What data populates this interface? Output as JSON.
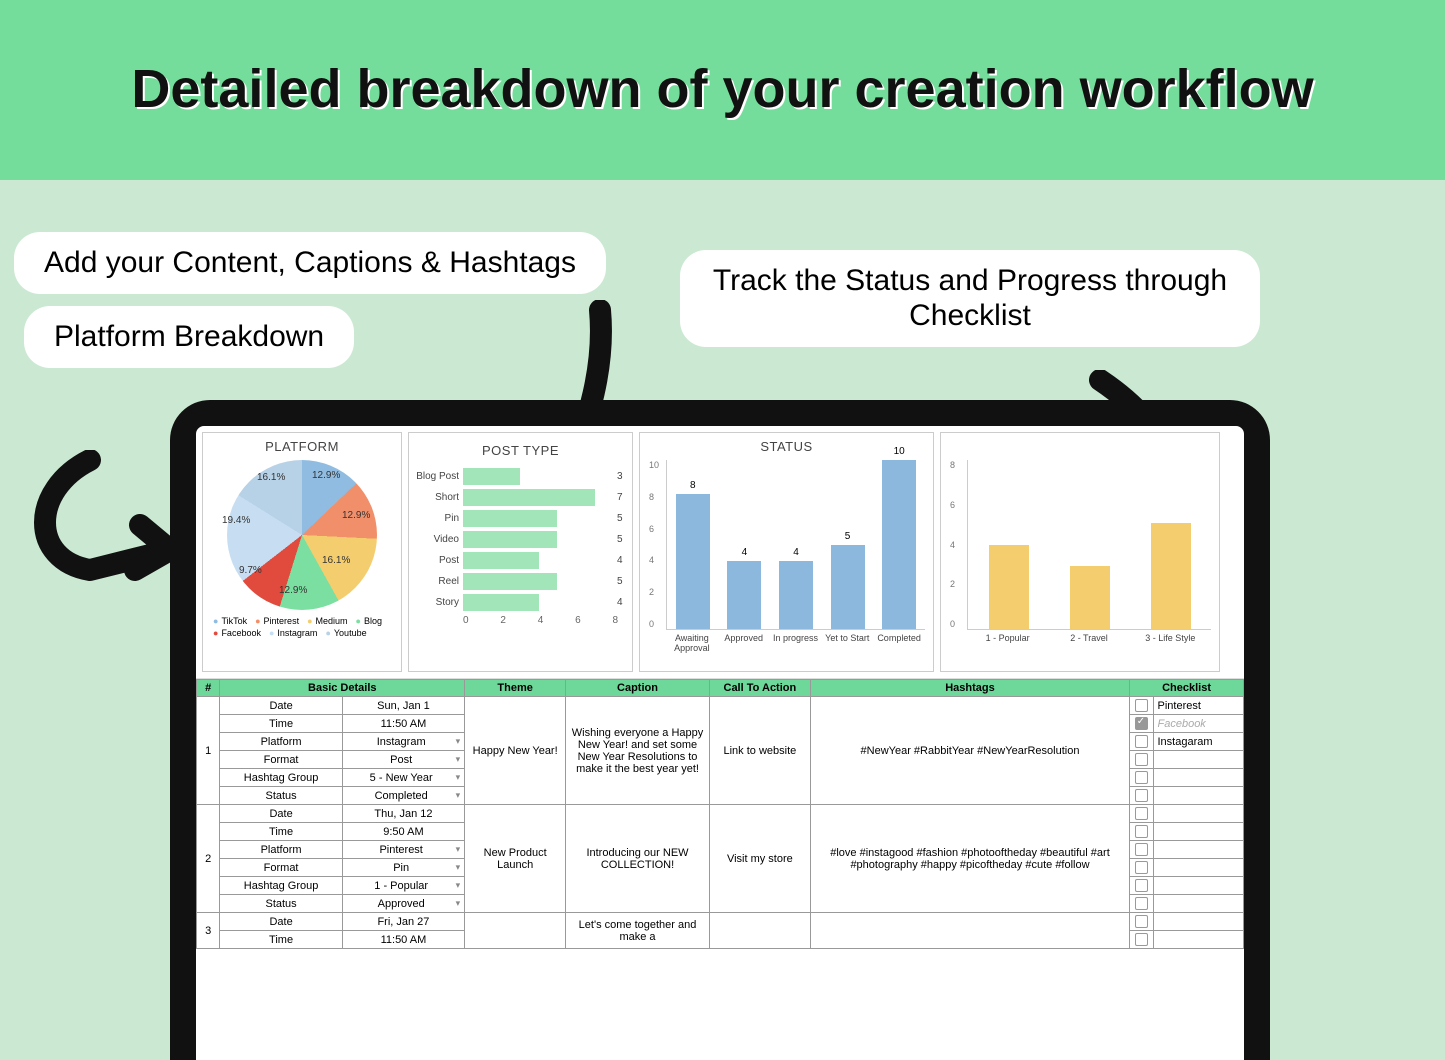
{
  "header": {
    "title": "Detailed breakdown of your creation workflow"
  },
  "callouts": {
    "c1": "Add your Content, Captions & Hashtags",
    "c2": "Platform  Breakdown",
    "c3": "Track the Status and Progress through Checklist"
  },
  "charts": {
    "platform": {
      "title": "PLATFORM",
      "slices": [
        {
          "label": "TikTok",
          "pct": "12.9%"
        },
        {
          "label": "Pinterest",
          "pct": "12.9%"
        },
        {
          "label": "Medium",
          "pct": "16.1%"
        },
        {
          "label": "Blog",
          "pct": "12.9%"
        },
        {
          "label": "Facebook",
          "pct": "9.7%"
        },
        {
          "label": "Instagram",
          "pct": "19.4%"
        },
        {
          "label": "Youtube",
          "pct": "16.1%"
        }
      ]
    },
    "posttype": {
      "title": "POST TYPE",
      "items": [
        {
          "label": "Blog Post",
          "value": 3
        },
        {
          "label": "Short",
          "value": 7
        },
        {
          "label": "Pin",
          "value": 5
        },
        {
          "label": "Video",
          "value": 5
        },
        {
          "label": "Post",
          "value": 4
        },
        {
          "label": "Reel",
          "value": 5
        },
        {
          "label": "Story",
          "value": 4
        }
      ],
      "axis": [
        "0",
        "2",
        "4",
        "6",
        "8"
      ]
    },
    "status": {
      "title": "STATUS",
      "items": [
        {
          "label": "Awaiting Approval",
          "value": 8
        },
        {
          "label": "Approved",
          "value": 4
        },
        {
          "label": "In progress",
          "value": 4
        },
        {
          "label": "Yet to Start",
          "value": 5
        },
        {
          "label": "Completed",
          "value": 10
        }
      ],
      "yticks": [
        "10",
        "8",
        "6",
        "4",
        "2",
        "0"
      ]
    },
    "theme": {
      "yticks": [
        "8",
        "6",
        "4",
        "2",
        "0"
      ],
      "items": [
        {
          "label": "1 - Popular",
          "value": 4
        },
        {
          "label": "2 - Travel",
          "value": 3
        },
        {
          "label": "3 - Life Style",
          "value": 5
        }
      ]
    }
  },
  "sheet": {
    "headers": {
      "num": "#",
      "basic": "Basic Details",
      "theme": "Theme",
      "caption": "Caption",
      "cta": "Call To Action",
      "hashtags": "Hashtags",
      "checklist": "Checklist"
    },
    "rowlabels": [
      "Date",
      "Time",
      "Platform",
      "Format",
      "Hashtag Group",
      "Status"
    ],
    "rows": [
      {
        "num": "1",
        "vals": [
          "Sun, Jan 1",
          "11:50 AM",
          "Instagram",
          "Post",
          "5 - New Year",
          "Completed"
        ],
        "theme": "Happy New Year!",
        "caption": "Wishing everyone a Happy New Year! and set some New Year Resolutions to make it the best year yet!",
        "cta": "Link to website",
        "hashtags": "#NewYear #RabbitYear #NewYearResolution",
        "chk": [
          {
            "label": "Pinterest",
            "on": false
          },
          {
            "label": "Facebook",
            "on": true,
            "faded": true
          },
          {
            "label": "Instagaram",
            "on": false
          },
          {
            "label": "",
            "on": false
          },
          {
            "label": "",
            "on": false
          },
          {
            "label": "",
            "on": false
          }
        ]
      },
      {
        "num": "2",
        "vals": [
          "Thu, Jan 12",
          "9:50 AM",
          "Pinterest",
          "Pin",
          "1 - Popular",
          "Approved"
        ],
        "theme": "New Product Launch",
        "caption": "Introducing our NEW COLLECTION!",
        "cta": "Visit my store",
        "hashtags": "#love #instagood #fashion #photooftheday #beautiful #art #photography #happy #picoftheday #cute #follow",
        "chk": [
          {
            "label": "",
            "on": false
          },
          {
            "label": "",
            "on": false
          },
          {
            "label": "",
            "on": false
          },
          {
            "label": "",
            "on": false
          },
          {
            "label": "",
            "on": false
          },
          {
            "label": "",
            "on": false
          }
        ]
      },
      {
        "num": "3",
        "vals": [
          "Fri, Jan 27",
          "11:50 AM"
        ],
        "theme": "",
        "caption": "Let's come together and make a",
        "cta": "",
        "hashtags": "",
        "chk": [
          {
            "label": "",
            "on": false
          },
          {
            "label": "",
            "on": false
          }
        ]
      }
    ]
  },
  "chart_data": [
    {
      "type": "pie",
      "title": "PLATFORM",
      "categories": [
        "TikTok",
        "Pinterest",
        "Medium",
        "Blog",
        "Facebook",
        "Instagram",
        "Youtube"
      ],
      "values": [
        12.9,
        12.9,
        16.1,
        12.9,
        9.7,
        19.4,
        16.1
      ]
    },
    {
      "type": "bar",
      "title": "POST TYPE",
      "orientation": "horizontal",
      "categories": [
        "Blog Post",
        "Short",
        "Pin",
        "Video",
        "Post",
        "Reel",
        "Story"
      ],
      "values": [
        3,
        7,
        5,
        5,
        4,
        5,
        4
      ],
      "xlim": [
        0,
        8
      ]
    },
    {
      "type": "bar",
      "title": "STATUS",
      "categories": [
        "Awaiting Approval",
        "Approved",
        "In progress",
        "Yet to Start",
        "Completed"
      ],
      "values": [
        8,
        4,
        4,
        5,
        10
      ],
      "ylim": [
        0,
        10
      ]
    },
    {
      "type": "bar",
      "title": "THEME",
      "categories": [
        "1 - Popular",
        "2 - Travel",
        "3 - Life Style"
      ],
      "values": [
        4,
        3,
        5
      ],
      "ylim": [
        0,
        8
      ]
    }
  ]
}
